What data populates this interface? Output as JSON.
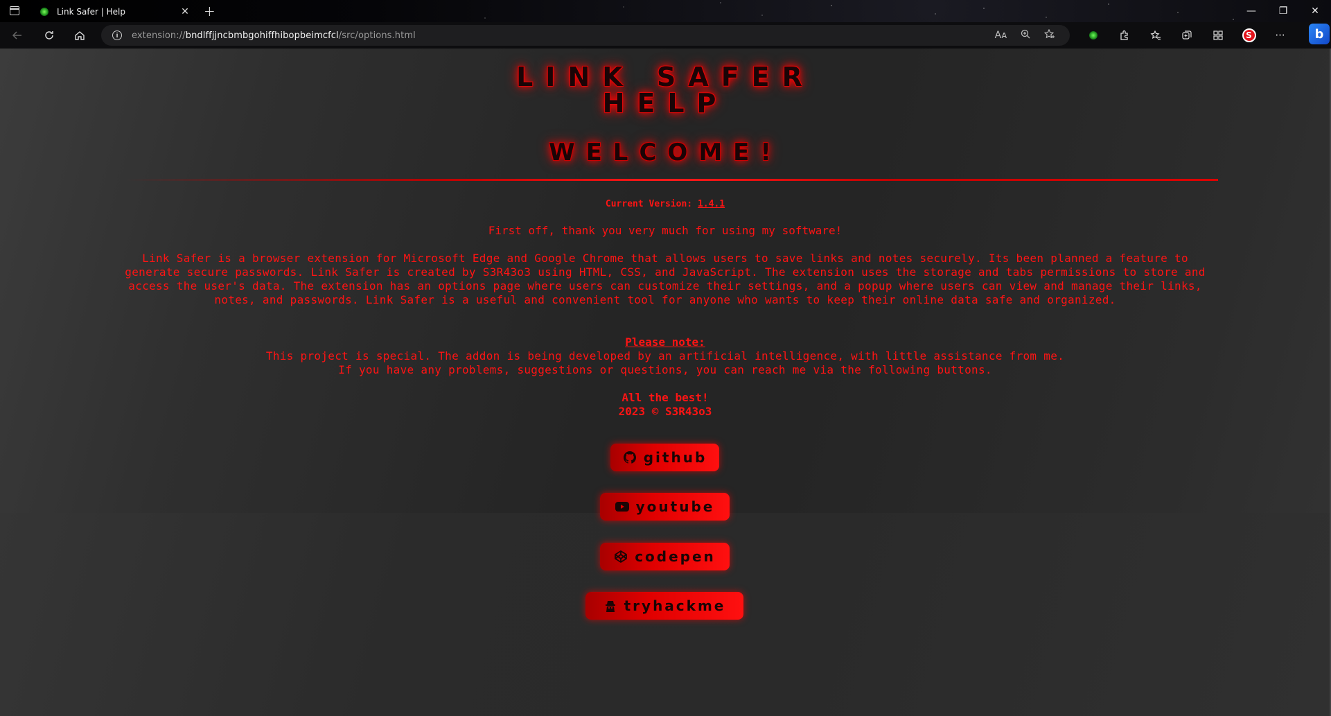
{
  "browser": {
    "tab_title": "Link Safer | Help",
    "tab_close": "✕",
    "new_tab": "+",
    "url_scheme": "extension://",
    "url_host": "bndlffjjncbmbgohiffhibopbeimcfcl",
    "url_path": "/src/options.html",
    "window_controls": [
      "—",
      "❐",
      "✕"
    ]
  },
  "page": {
    "title": "LINK SAFER",
    "subtitle_line": "HELP",
    "welcome": "WELCOME!",
    "version_label": "Current Version:",
    "version_value": "1.4.1",
    "thanks": "First off, thank you very much for using my software!",
    "about": "Link Safer is a browser extension for Microsoft Edge and Google Chrome that allows users to save links and notes securely. Its been planned a feature to generate secure passwords. Link Safer is created by S3R43o3 using HTML, CSS, and JavaScript. The extension uses the storage and tabs permissions to store and access the user's data. The extension has an options page where users can customize their settings, and a popup where users can view and manage their links, notes, and passwords. Link Safer is a useful and convenient tool for anyone who wants to keep their online data safe and organized.",
    "note_heading": "Please note:",
    "note_line1": "This project is special. The addon is being developed by an artificial intelligence, with little assistance from me.",
    "note_line2": "If you have any problems, suggestions or questions, you can reach me via the following buttons.",
    "best": "All the best!",
    "copyright": "2023 © S3R43o3"
  },
  "buttons": [
    {
      "label": "github",
      "icon": "github-icon"
    },
    {
      "label": "youtube",
      "icon": "youtube-icon"
    },
    {
      "label": "codepen",
      "icon": "codepen-icon"
    },
    {
      "label": "tryhackme",
      "icon": "tryhackme-icon"
    }
  ],
  "colors": {
    "accent": "#ff1414",
    "button_dark": "#a80000",
    "button_light": "#ff1010",
    "page_bg": "#252525"
  }
}
